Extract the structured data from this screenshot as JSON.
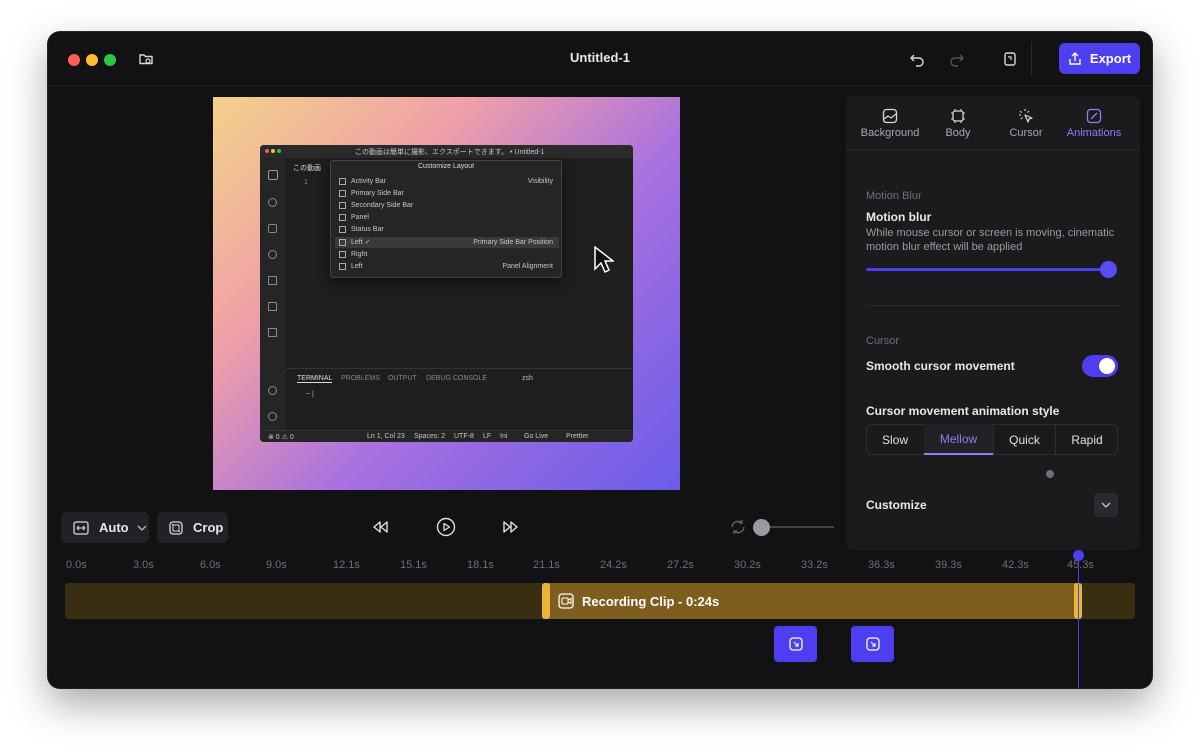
{
  "window": {
    "title": "Untitled-1",
    "export_label": "Export"
  },
  "colors": {
    "accent": "#4d3ef0",
    "clip": "#7d5e1e",
    "clip_handle": "#e9b43a"
  },
  "preview": {
    "vscode_title": "この動画は簡単に撮影、エクスポートできます。 • Untitled-1",
    "explorer_tab": "この動画",
    "line_number": "1",
    "menu_title": "Customize Layout",
    "menu_items": [
      {
        "label": "Activity Bar",
        "right": "Visibility"
      },
      {
        "label": "Primary Side Bar",
        "right": ""
      },
      {
        "label": "Secondary Side Bar",
        "right": ""
      },
      {
        "label": "Panel",
        "right": ""
      },
      {
        "label": "Status Bar",
        "right": ""
      },
      {
        "label": "Left ✓",
        "right": "Primary Side Bar Position"
      },
      {
        "label": "Right",
        "right": ""
      },
      {
        "label": "Left",
        "right": "Panel Alignment"
      }
    ],
    "panel_tabs": [
      "TERMINAL",
      "PROBLEMS",
      "OUTPUT",
      "DEBUG CONSOLE"
    ],
    "terminal_shell": "zsh",
    "terminal_prompt": "~ |",
    "status_left": "⊗ 0 ⚠ 0",
    "status_items": [
      "Ln 1, Col 23",
      "Spaces: 2",
      "UTF-8",
      "LF",
      "Ini",
      "Go Live",
      "Prettier"
    ]
  },
  "controls": {
    "auto_label": "Auto",
    "crop_label": "Crop"
  },
  "panel": {
    "tabs": [
      "Background",
      "Body",
      "Cursor",
      "Animations"
    ],
    "active_tab": "Animations",
    "motion_blur": {
      "section": "Motion Blur",
      "title": "Motion blur",
      "description": "While mouse cursor or screen is moving, cinematic motion blur effect will be applied",
      "value_fraction": 1.0
    },
    "cursor": {
      "section": "Cursor",
      "smooth_label": "Smooth cursor movement",
      "smooth_on": true,
      "style_label": "Cursor movement animation style",
      "styles": [
        "Slow",
        "Mellow",
        "Quick",
        "Rapid"
      ],
      "selected_style": "Mellow"
    },
    "customize_label": "Customize"
  },
  "timeline": {
    "ticks": [
      "0.0s",
      "3.0s",
      "6.0s",
      "9.0s",
      "12.1s",
      "15.1s",
      "18.1s",
      "21.1s",
      "24.2s",
      "27.2s",
      "30.2s",
      "33.2s",
      "36.3s",
      "39.3s",
      "42.3s",
      "45.3s"
    ],
    "clip_label": "Recording Clip - 0:24s"
  }
}
